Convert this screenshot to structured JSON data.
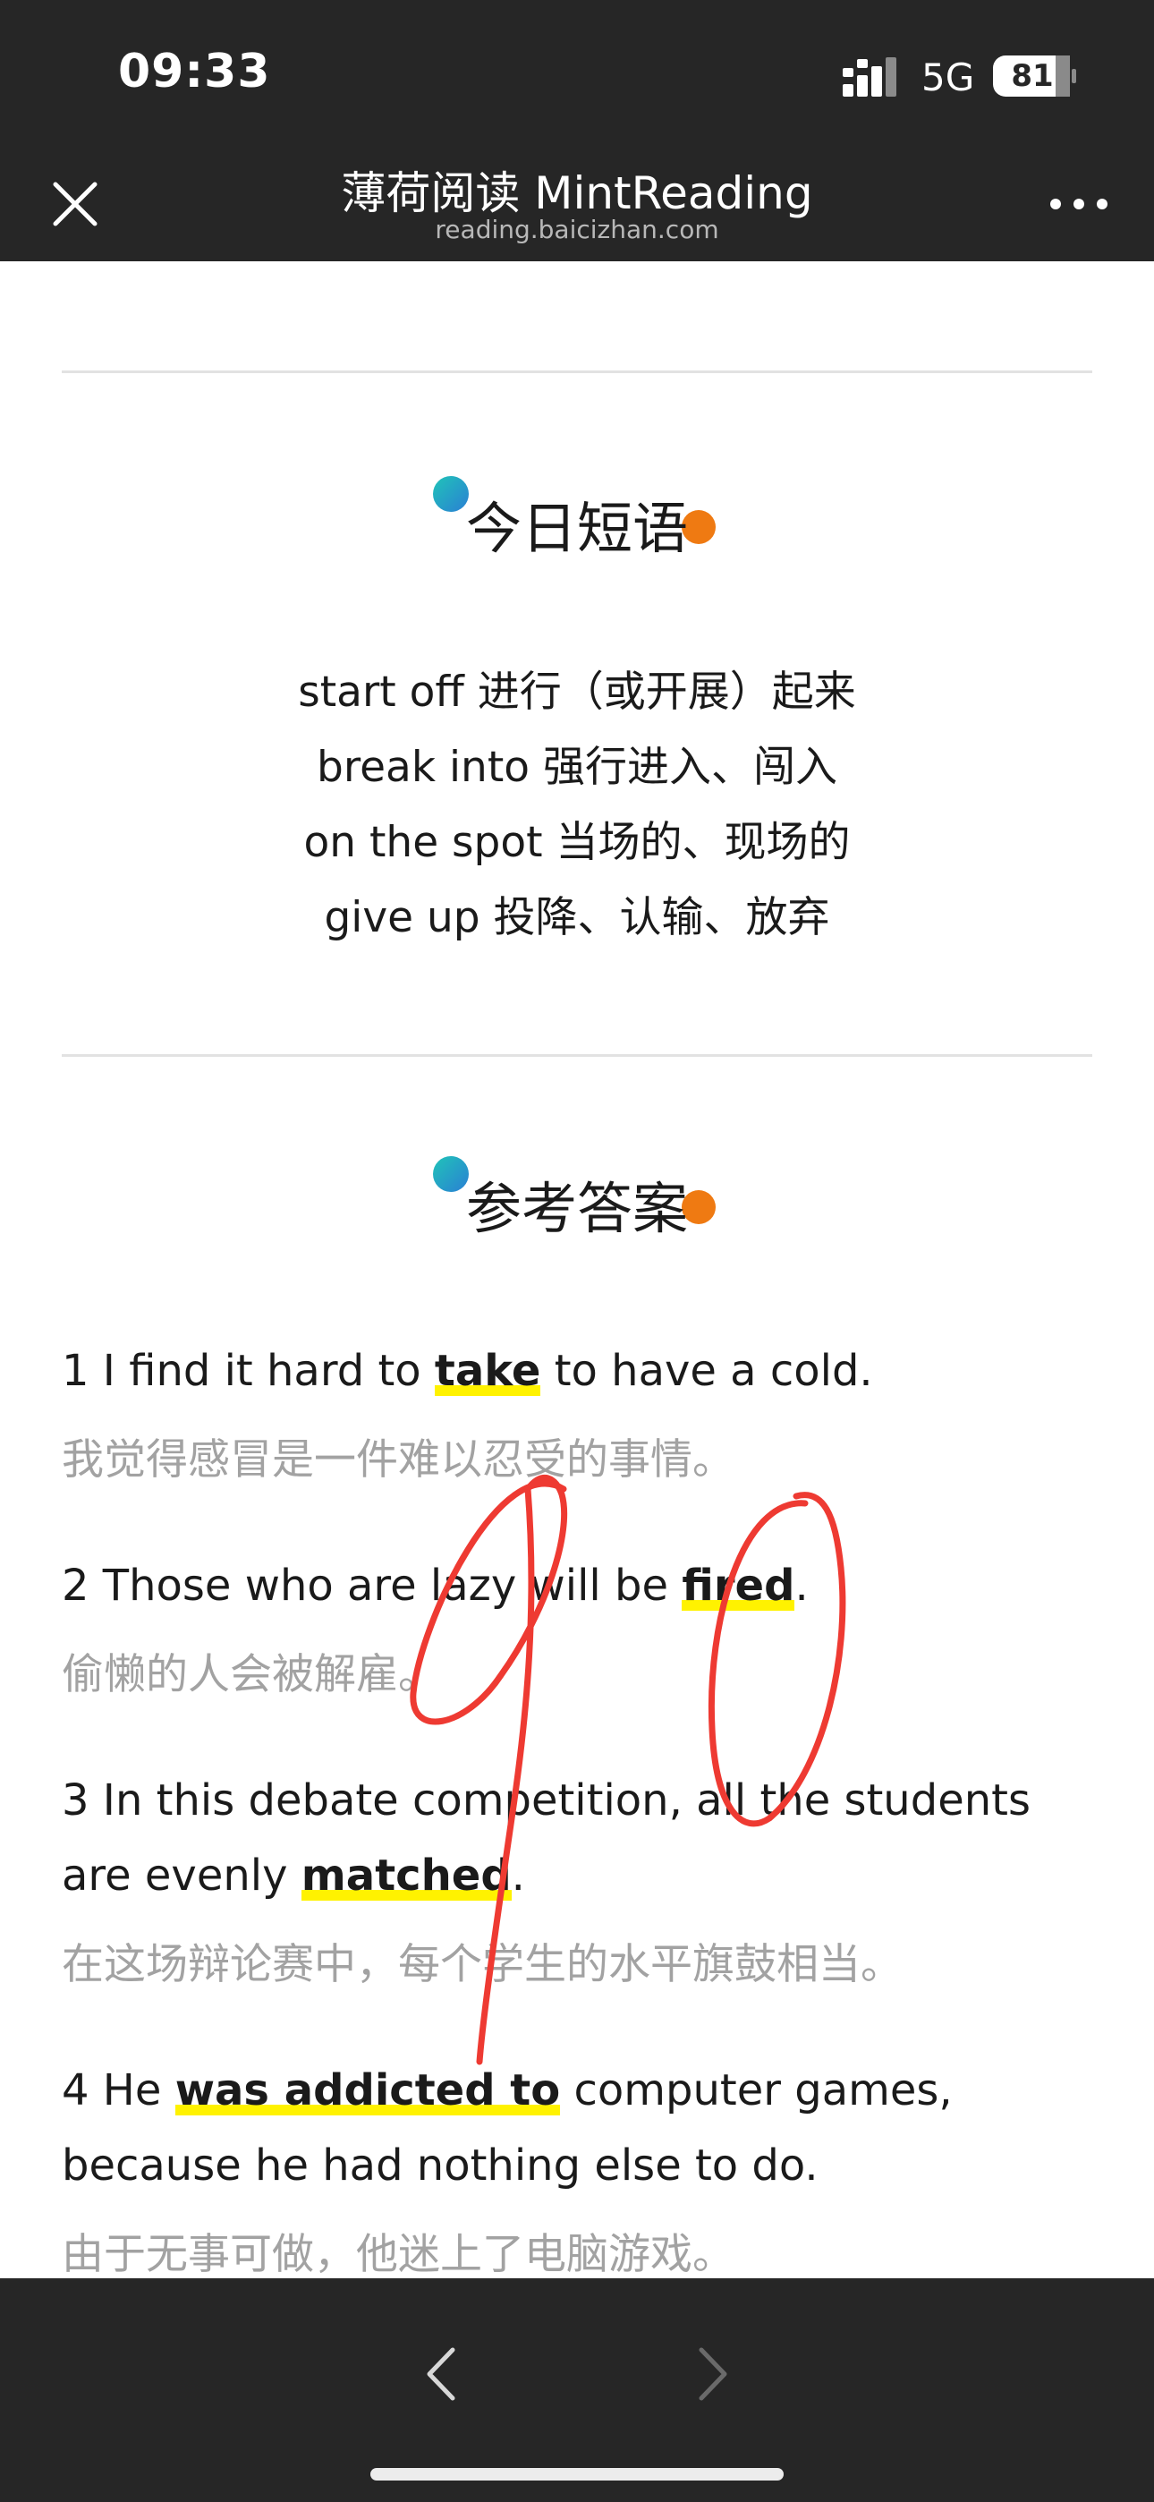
{
  "status_bar": {
    "time": "09:33",
    "network": "5G",
    "battery": "81"
  },
  "nav": {
    "title": "薄荷阅读 MintReading",
    "subtitle": "reading.baicizhan.com",
    "close_icon": "close-icon",
    "more_icon": "more-icon"
  },
  "phrases_section": {
    "title": "今日短语",
    "items": [
      "start off 进行（或开展）起来",
      "break into 强行进入、闯入",
      "on the spot 当场的、现场的",
      "give up 投降、认输、放弃"
    ]
  },
  "answers_section": {
    "title": "参考答案",
    "items": [
      {
        "before": "1 I find it hard to ",
        "answer": "take",
        "after": " to have a cold.",
        "translation": "我觉得感冒是一件难以忍受的事情。"
      },
      {
        "before": "2 Those who are lazy will be ",
        "answer": "fired",
        "after": ".",
        "translation": "偷懒的人会被解雇。"
      },
      {
        "before": "3 In this debate competition, all the students are evenly ",
        "answer": "matched",
        "after": ".",
        "translation": "在这场辩论赛中，每个学生的水平旗鼓相当。"
      },
      {
        "before": "4 He ",
        "answer": "was addicted to",
        "after": " computer games, because he had nothing else to do.",
        "translation": "由于无事可做，他迷上了电脑游戏。"
      }
    ]
  },
  "annotation": {
    "color": "#ee3a32",
    "handwritten_mark": "90"
  },
  "colors": {
    "bar_background": "#262626",
    "highlight": "#fff200",
    "accent_orange": "#ef7a12",
    "accent_teal": "#20c4b8"
  },
  "bottom_nav": {
    "back_icon": "chevron-left-icon",
    "forward_icon": "chevron-right-icon"
  }
}
